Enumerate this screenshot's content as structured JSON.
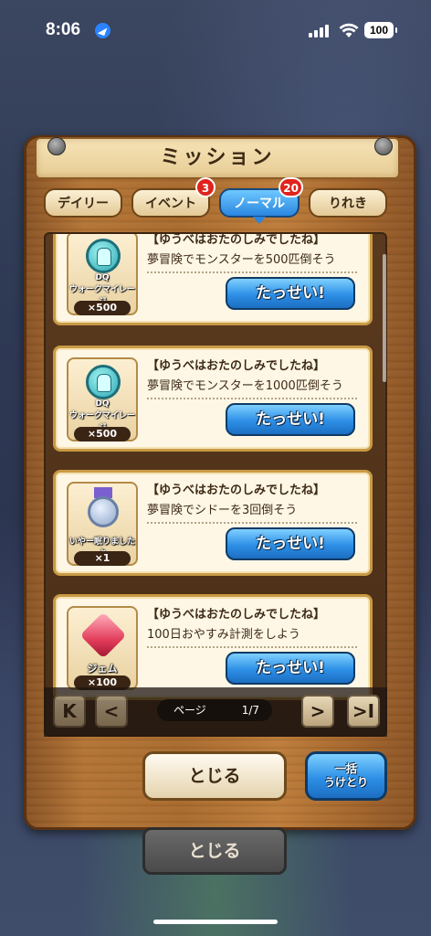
{
  "status_bar": {
    "time": "8:06",
    "battery": "100"
  },
  "dialog": {
    "title": "ミッション",
    "tabs": [
      {
        "label": "デイリー",
        "badge": ""
      },
      {
        "label": "イベント",
        "badge": "3"
      },
      {
        "label": "ノーマル",
        "badge": "20",
        "active": true
      },
      {
        "label": "りれき",
        "badge": ""
      }
    ],
    "missions": [
      {
        "category": "【ゆうべはおたのしみでしたね】",
        "description": "夢冒険でモンスターを500匹倒そう",
        "reward_label": "DQ\nウォークマイレージ",
        "reward_qty": "×500",
        "reward_icon": "walk-mileage-icon",
        "button": "たっせい!"
      },
      {
        "category": "【ゆうべはおたのしみでしたね】",
        "description": "夢冒険でモンスターを1000匹倒そう",
        "reward_label": "DQ\nウォークマイレージ",
        "reward_qty": "×500",
        "reward_icon": "walk-mileage-icon",
        "button": "たっせい!"
      },
      {
        "category": "【ゆうべはおたのしみでしたね】",
        "description": "夢冒険でシドーを3回倒そう",
        "reward_label": "いやー眠りましたよ",
        "reward_qty": "×1",
        "reward_icon": "medal-icon",
        "button": "たっせい!"
      },
      {
        "category": "【ゆうべはおたのしみでしたね】",
        "description": "100日おやすみ計測をしよう",
        "reward_label": "ジェム",
        "reward_qty": "×100",
        "reward_icon": "gem-icon",
        "button": "たっせい!"
      }
    ],
    "pager": {
      "label": "ページ",
      "value": "1/7",
      "first": "K",
      "prev": "<",
      "next": ">",
      "last": ">I"
    },
    "close_label": "とじる",
    "collect_all_label_line1": "一括",
    "collect_all_label_line2": "うけとり"
  },
  "background_close_label": "とじる",
  "colors": {
    "accent": "#2d8fe6",
    "wood": "#b47536",
    "badge": "#e0231c"
  }
}
